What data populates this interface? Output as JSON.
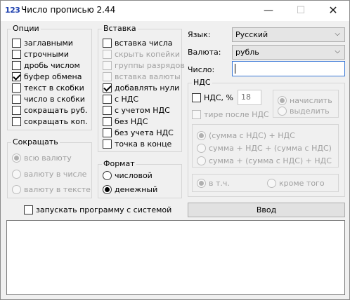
{
  "app": {
    "icon_text": "123",
    "title": "Число прописью 2.44"
  },
  "window_controls": {
    "minimize": "—",
    "maximize": "☐",
    "close": "✕"
  },
  "options": {
    "title": "Опции",
    "items": [
      {
        "label": "заглавными",
        "checked": false
      },
      {
        "label": "строчными",
        "checked": false
      },
      {
        "label": "дробь числом",
        "checked": false
      },
      {
        "label": "буфер обмена",
        "checked": true
      },
      {
        "label": "текст в скобки",
        "checked": false
      },
      {
        "label": "число в скобки",
        "checked": false
      },
      {
        "label": "сокращать руб.",
        "checked": false
      },
      {
        "label": "сокращать коп.",
        "checked": false
      }
    ]
  },
  "insert": {
    "title": "Вставка",
    "items": [
      {
        "label": "вставка числа",
        "checked": false,
        "disabled": false
      },
      {
        "label": "скрыть копейки",
        "checked": false,
        "disabled": true
      },
      {
        "label": "группы разрядов",
        "checked": false,
        "disabled": true
      },
      {
        "label": "вставка валюты",
        "checked": false,
        "disabled": true
      },
      {
        "label": "добавлять нули",
        "checked": true,
        "disabled": false
      },
      {
        "label": "с НДС",
        "checked": false,
        "disabled": false
      },
      {
        "label": "с учетом НДС",
        "checked": false,
        "disabled": false
      },
      {
        "label": "без НДС",
        "checked": false,
        "disabled": false
      },
      {
        "label": "без учета НДС",
        "checked": false,
        "disabled": false
      },
      {
        "label": "точка в конце",
        "checked": false,
        "disabled": false
      }
    ]
  },
  "abbreviate": {
    "title": "Сокращать",
    "items": [
      {
        "label": "всю валюту",
        "selected": true
      },
      {
        "label": "валюту в числе",
        "selected": false
      },
      {
        "label": "валюту в тексте",
        "selected": false
      }
    ]
  },
  "format": {
    "title": "Формат",
    "items": [
      {
        "label": "числовой",
        "selected": false
      },
      {
        "label": "денежный",
        "selected": true
      }
    ]
  },
  "autostart": {
    "label": "запускать программу с системой",
    "checked": false
  },
  "fields": {
    "language_label": "Язык:",
    "language_value": "Русский",
    "currency_label": "Валюта:",
    "currency_value": "рубль",
    "number_label": "Число:",
    "number_value": ""
  },
  "vat": {
    "title": "НДС",
    "vat_checkbox_label": "НДС, %",
    "rate": "18",
    "dash_label": "тире после НДС",
    "mode": [
      {
        "label": "начислить",
        "selected": true
      },
      {
        "label": "выделить",
        "selected": false
      }
    ],
    "formula": [
      {
        "label": "(сумма с НДС) + НДС",
        "selected": true
      },
      {
        "label": "сумма + НДС + (сумма с НДС)",
        "selected": false
      },
      {
        "label": "сумма + (сумма с НДС) + НДС",
        "selected": false
      }
    ],
    "inclusion": [
      {
        "label": "в т.ч.",
        "selected": true
      },
      {
        "label": "кроме того",
        "selected": false
      }
    ]
  },
  "enter_button": "Ввод"
}
